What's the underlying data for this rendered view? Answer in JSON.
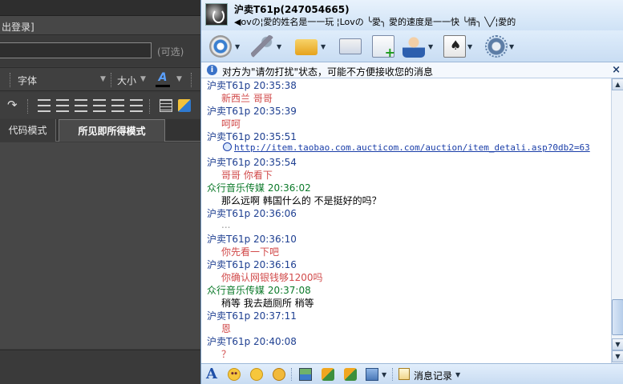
{
  "editor": {
    "login_text": "出登录]",
    "title_optional": "(可选)",
    "font_label": "字体",
    "size_label": "大小",
    "font_color_glyph": "A",
    "tabs": [
      {
        "label": "代码模式"
      },
      {
        "label": "所见即所得模式"
      }
    ]
  },
  "chat": {
    "contact_name": "沪卖T61p(247054665)",
    "signature": "◀ovの¦愛的姓名是一一玩   ¦Lovの ╰愛╮ 愛的速度是一一快   ╰情╮  ╲╱¦愛的",
    "notice": "对方为\"请勿打扰\"状态，可能不方便接收您的消息",
    "notice_close": "×",
    "messages": [
      {
        "sender": "沪卖T61p",
        "time": "20:35:38",
        "role": "seller",
        "body": "新西兰 哥哥",
        "body_color": "red"
      },
      {
        "sender": "沪卖T61p",
        "time": "20:35:39",
        "role": "seller",
        "body": "呵呵",
        "body_color": "red"
      },
      {
        "sender": "沪卖T61p",
        "time": "20:35:51",
        "role": "seller",
        "link": "http://item.taobao.com.aucticom.com/auction/item_detali.asp?0db2=63"
      },
      {
        "sender": "沪卖T61p",
        "time": "20:35:54",
        "role": "seller",
        "body": "哥哥 你看下",
        "body_color": "red"
      },
      {
        "sender": "众行音乐传媒",
        "time": "20:36:02",
        "role": "buyer",
        "body": "那么远啊  韩国什么的  不是挺好的吗？",
        "body_color": "black"
      },
      {
        "sender": "沪卖T61p",
        "time": "20:36:06",
        "role": "seller",
        "body": "...",
        "body_color": "gray"
      },
      {
        "sender": "沪卖T61p",
        "time": "20:36:10",
        "role": "seller",
        "body": "你先看一下吧",
        "body_color": "red"
      },
      {
        "sender": "沪卖T61p",
        "time": "20:36:16",
        "role": "seller",
        "body": "你确认网银钱够1200吗",
        "body_color": "red"
      },
      {
        "sender": "众行音乐传媒",
        "time": "20:37:08",
        "role": "buyer",
        "body": "稍等    我去趟厕所    稍等",
        "body_color": "black"
      },
      {
        "sender": "沪卖T61p",
        "time": "20:37:11",
        "role": "seller",
        "body": "恩",
        "body_color": "red"
      },
      {
        "sender": "沪卖T61p",
        "time": "20:40:08",
        "role": "seller",
        "body": "？",
        "body_color": "red"
      }
    ],
    "toolbar_icons": [
      "video-call-icon",
      "voice-call-icon",
      "send-file-icon",
      "mail-icon",
      "add-note-icon",
      "customer-service-icon",
      "game-icon",
      "settings-icon"
    ],
    "input_toolbar": {
      "font_glyph": "A",
      "history_label": "消息记录"
    }
  }
}
